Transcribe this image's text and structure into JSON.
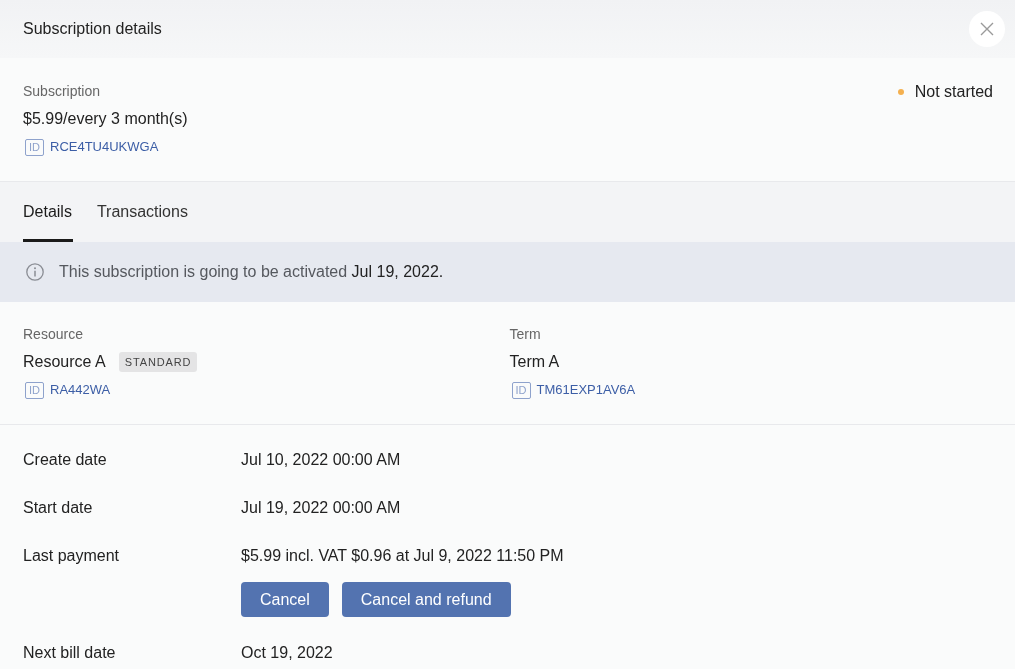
{
  "header": {
    "title": "Subscription details"
  },
  "subscription": {
    "label": "Subscription",
    "price": "$5.99/every 3 month(s)",
    "id": {
      "badge": "ID",
      "value": "RCE4TU4UKWGA"
    },
    "status": {
      "text": "Not started",
      "color": "#f4b04f"
    }
  },
  "tabs": [
    {
      "label": "Details",
      "selected": true
    },
    {
      "label": "Transactions",
      "selected": false
    }
  ],
  "notice": {
    "text": "This subscription is going to be activated",
    "date": "Jul 19, 2022."
  },
  "items": [
    {
      "label": "Resource",
      "name": "Resource A",
      "tag": "STANDARD",
      "id": {
        "badge": "ID",
        "value": "RA442WA"
      }
    },
    {
      "label": "Term",
      "name": "Term A",
      "id": {
        "badge": "ID",
        "value": "TM61EXP1AV6A"
      }
    }
  ],
  "fields": [
    {
      "label": "Create date",
      "value": "Jul 10, 2022 00:00 AM"
    },
    {
      "label": "Start date",
      "value": "Jul 19, 2022 00:00 AM"
    },
    {
      "label": "Last payment",
      "value": "$5.99 incl. VAT $0.96 at Jul 9, 2022 11:50 PM",
      "actions": [
        "Cancel",
        "Cancel and refund"
      ]
    },
    {
      "label": "Next bill date",
      "value": "Oct 19, 2022"
    }
  ]
}
